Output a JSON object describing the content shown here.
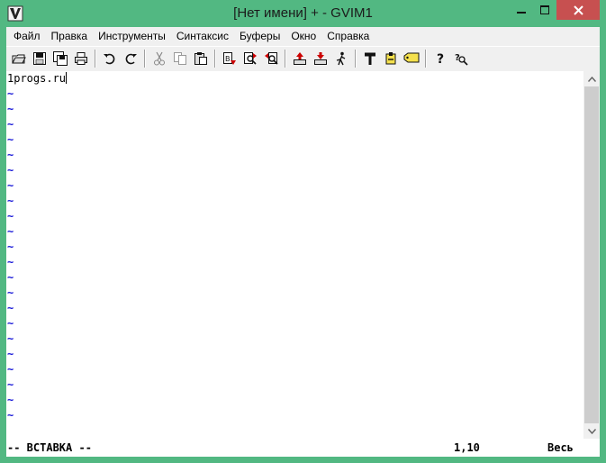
{
  "window": {
    "title": "[Нет имени] + - GVIM1",
    "accent_color": "#52b882",
    "close_color": "#c75050"
  },
  "menu": {
    "items": [
      "Файл",
      "Правка",
      "Инструменты",
      "Синтаксис",
      "Буферы",
      "Окно",
      "Справка"
    ]
  },
  "toolbar": {
    "groups": [
      [
        "open-icon",
        "save-icon",
        "save-all-icon",
        "print-icon"
      ],
      [
        "undo-icon",
        "redo-icon"
      ],
      [
        "cut-icon",
        "copy-icon",
        "paste-icon"
      ],
      [
        "replace-icon",
        "find-next-icon",
        "find-prev-icon"
      ],
      [
        "load-session-icon",
        "save-session-icon",
        "run-script-icon"
      ],
      [
        "make-icon",
        "shell-icon",
        "tag-icon"
      ],
      [
        "help-icon",
        "find-help-icon"
      ]
    ]
  },
  "editor": {
    "first_line": "1progs.ru",
    "tilde": "~",
    "tilde_count": 22
  },
  "status": {
    "mode": "-- ВСТАВКА --",
    "position": "1,10",
    "scroll": "Весь"
  }
}
